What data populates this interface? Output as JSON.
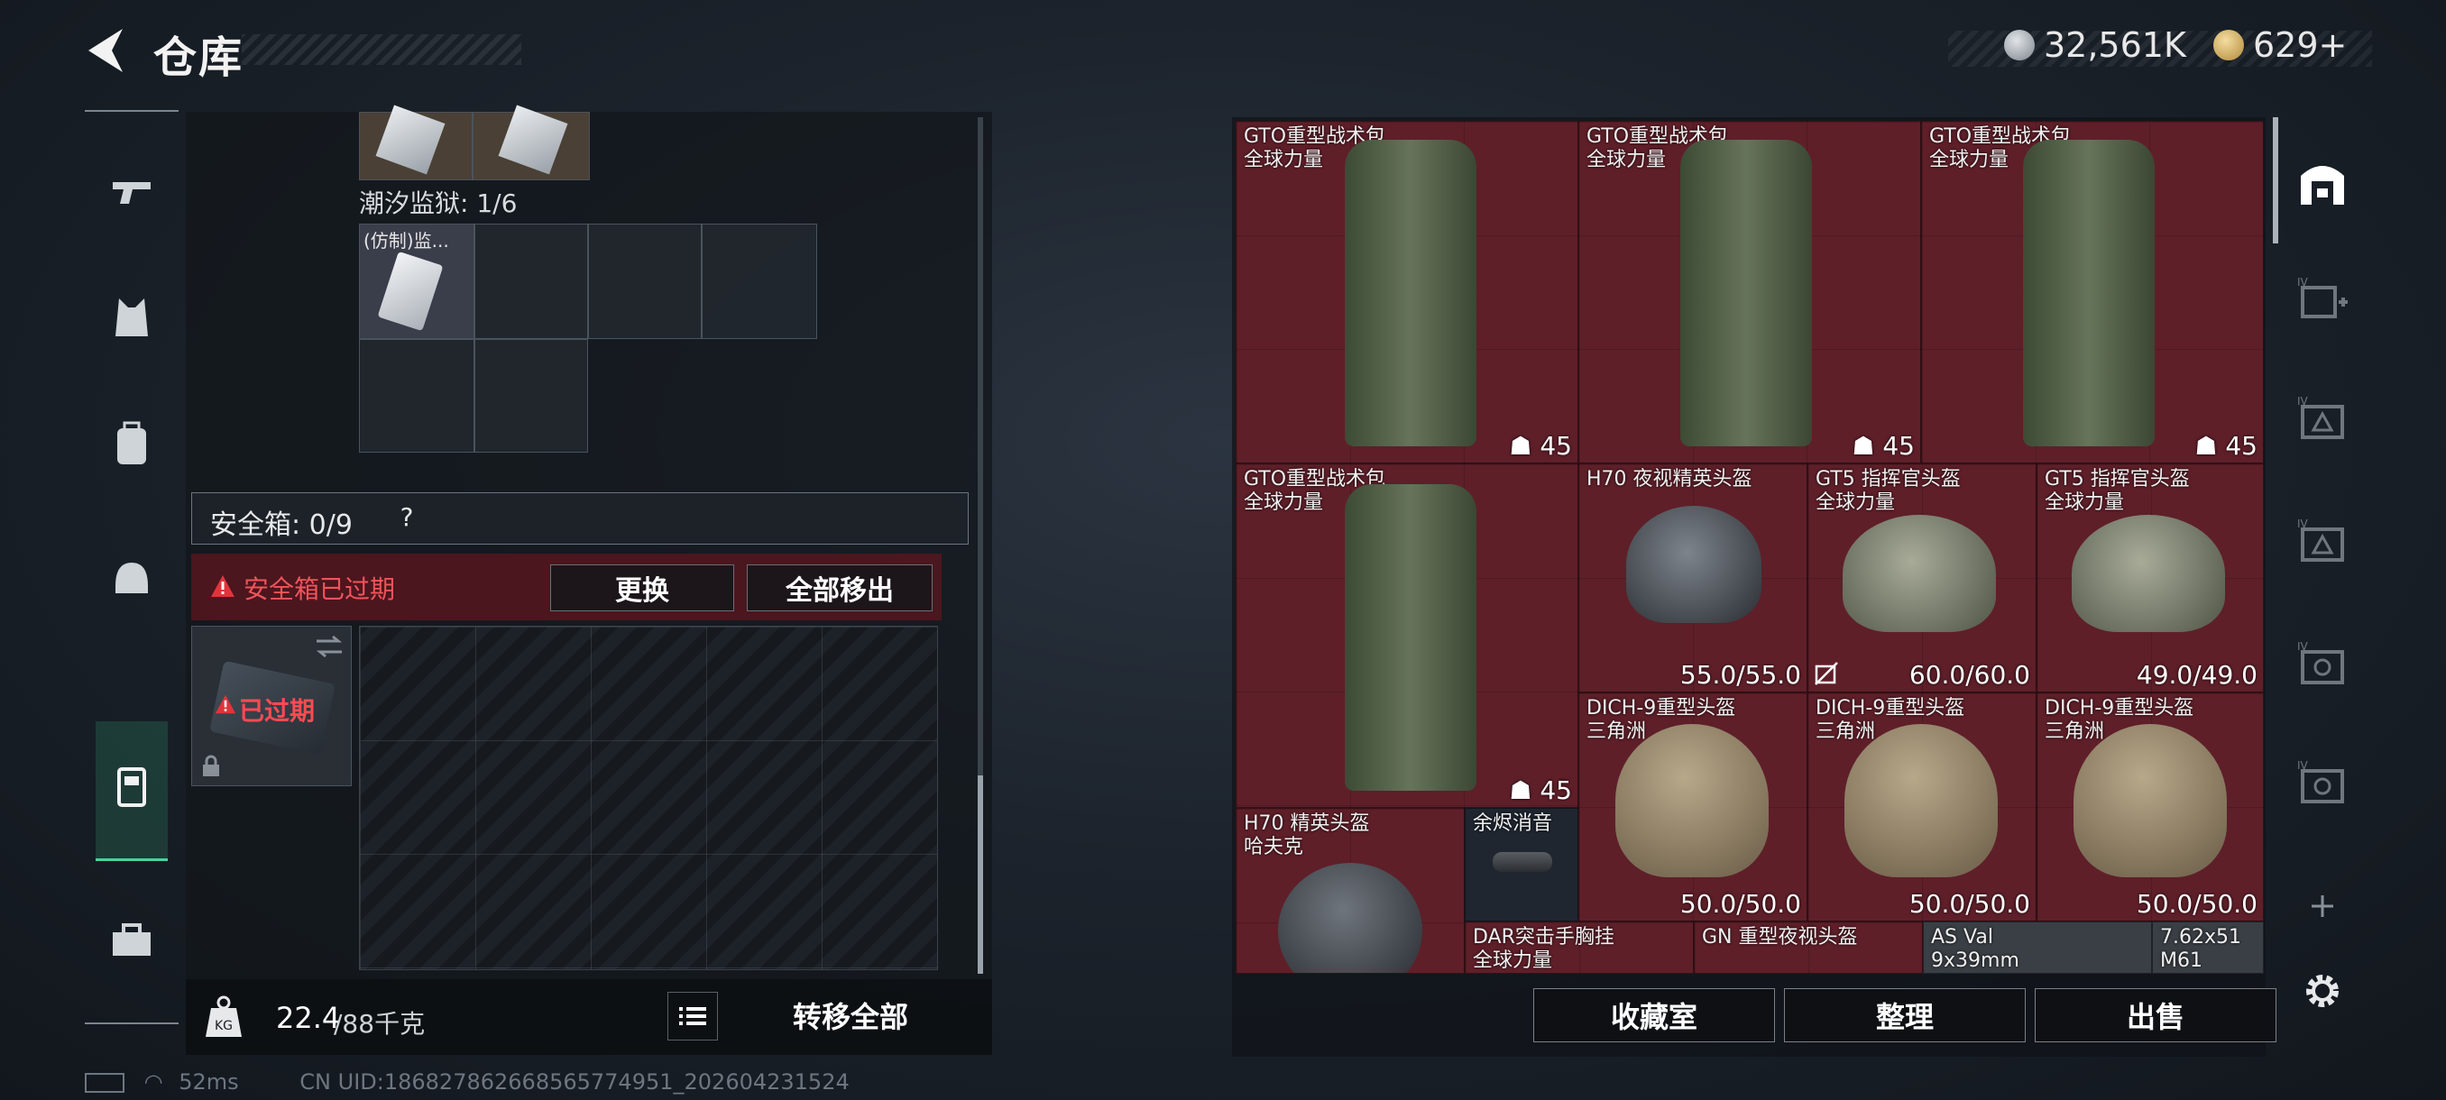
{
  "header": {
    "title": "仓库",
    "currency_silver": "32,561K",
    "currency_gold": "629+"
  },
  "left": {
    "prison_label": "潮汐监狱: 1/6",
    "prison_item_name": "(仿制)监...",
    "safebox_label": "安全箱: 0/9",
    "help": "?",
    "expired_warning": "安全箱已过期",
    "replace_button": "更换",
    "move_all_out_button": "全部移出",
    "expired_tag": "已过期",
    "weight_value": "22.4",
    "weight_max": "/88千克",
    "transfer_all_button": "转移全部"
  },
  "items": [
    {
      "name": "GTO重型战术包",
      "sub": "全球力量",
      "value": "45"
    },
    {
      "name": "GTO重型战术包",
      "sub": "全球力量",
      "value": "45"
    },
    {
      "name": "GTO重型战术包",
      "sub": "全球力量",
      "value": "45"
    },
    {
      "name": "GTO重型战术包",
      "sub": "全球力量",
      "value": "45"
    },
    {
      "name": "H70 夜视精英头盔",
      "sub": "",
      "value": "55.0/55.0"
    },
    {
      "name": "GT5 指挥官头盔",
      "sub": "全球力量",
      "value": "60.0/60.0"
    },
    {
      "name": "GT5 指挥官头盔",
      "sub": "全球力量",
      "value": "49.0/49.0"
    },
    {
      "name": "DICH-9重型头盔",
      "sub": "三角洲",
      "value": "50.0/50.0"
    },
    {
      "name": "DICH-9重型头盔",
      "sub": "三角洲",
      "value": "50.0/50.0"
    },
    {
      "name": "DICH-9重型头盔",
      "sub": "三角洲",
      "value": "50.0/50.0"
    },
    {
      "name": "H70 精英头盔",
      "sub": "哈夫克",
      "value": ""
    },
    {
      "name": "余烬消音",
      "sub": "",
      "value": ""
    },
    {
      "name": "DAR突击手胸挂",
      "sub": "全球力量",
      "value": ""
    },
    {
      "name": "GN 重型夜视头盔",
      "sub": "",
      "value": ""
    },
    {
      "name": "AS Val",
      "sub": "9x39mm",
      "value": ""
    },
    {
      "name": "7.62x51",
      "sub": "M61",
      "value": ""
    }
  ],
  "bottom_buttons": {
    "collection": "收藏室",
    "organize": "整理",
    "sell": "出售"
  },
  "status": {
    "ping": "52ms",
    "uid": "CN UID:1868278626685657749​51_202604231524"
  },
  "colors": {
    "item_red": "#5e1f29",
    "accent_green": "#46d39a",
    "warning_red": "#e0343c"
  }
}
